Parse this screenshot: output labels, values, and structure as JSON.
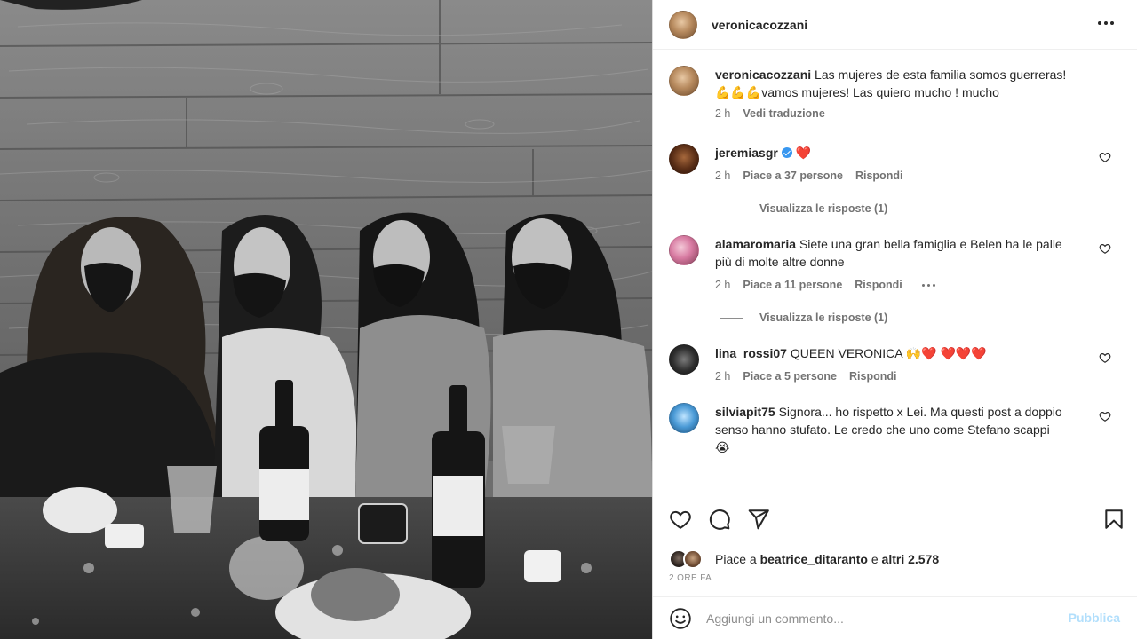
{
  "post": {
    "author": "veronicacozzani",
    "caption_user": "veronicacozzani",
    "caption_text": "Las mujeres de esta familia somos guerreras! 💪💪💪vamos mujeres! Las quiero mucho ! mucho",
    "caption_time": "2 h",
    "translate_label": "Vedi traduzione",
    "photo_alt": "black and white photo"
  },
  "comments": [
    {
      "user": "jeremiasgr",
      "verified": true,
      "text": "❤️",
      "time": "2 h",
      "likes": "Piace a 37 persone",
      "reply": "Rispondi",
      "view_replies": "Visualizza le risposte (1)"
    },
    {
      "user": "alamaromaria",
      "text": "Siete una gran bella famiglia e Belen ha le palle più di molte altre donne",
      "time": "2 h",
      "likes": "Piace a 11 persone",
      "reply": "Rispondi",
      "view_replies": "Visualizza le risposte (1)"
    },
    {
      "user": "lina_rossi07",
      "text": "QUEEN VERONICA 🙌❤️ ❤️❤️❤️",
      "time": "2 h",
      "likes": "Piace a 5 persone",
      "reply": "Rispondi"
    },
    {
      "user": "silviapit75",
      "text": "Signora... ho rispetto x Lei. Ma questi post a doppio senso hanno stufato. Le credo che uno come Stefano scappi 😭"
    }
  ],
  "likes": {
    "prefix": "Piace a ",
    "user": "beatrice_ditaranto",
    "middle": " e ",
    "others": "altri 2.578"
  },
  "time_ago": "2 ORE FA",
  "add_comment": {
    "placeholder": "Aggiungi un commento...",
    "publish_label": "Pubblica"
  },
  "icons": [
    "more-icon",
    "heart-icon",
    "comment-icon",
    "share-icon",
    "bookmark-icon",
    "emoji-icon",
    "verified-icon"
  ],
  "colors": {
    "text": "#262626",
    "secondary": "#737373",
    "publish_disabled": "#b2dffc",
    "verified": "#3897f0",
    "border": "#dbdbdb"
  }
}
